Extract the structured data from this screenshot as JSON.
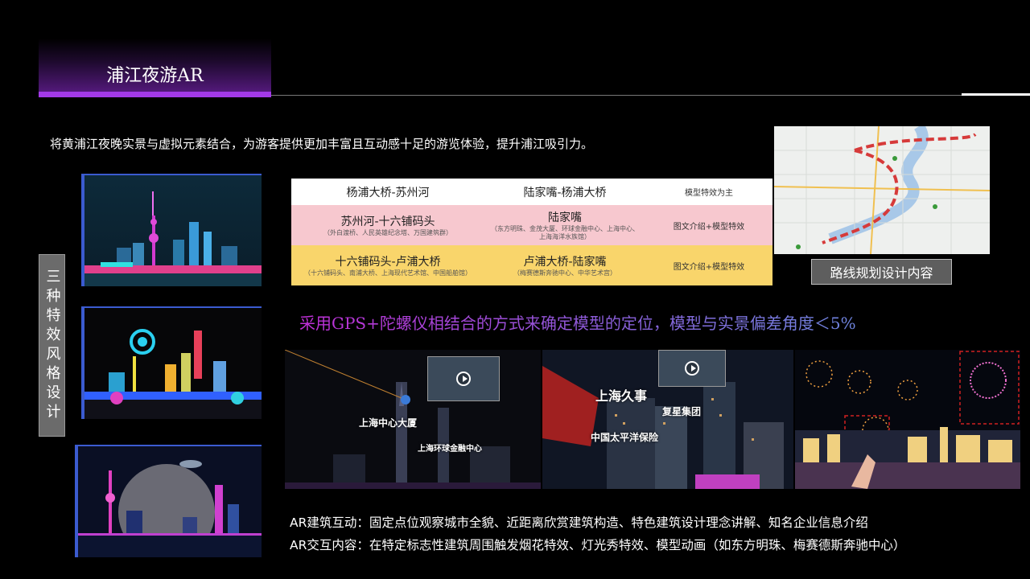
{
  "header": {
    "title": "浦江夜游AR"
  },
  "intro": "将黄浦江夜晚实景与虚拟元素结合，为游客提供更加丰富且互动感十足的游览体验，提升浦江吸引力。",
  "side_label": "三种特效风格设计",
  "route_table": {
    "header": [
      "杨浦大桥-苏州河",
      "陆家嘴-杨浦大桥",
      "模型特效为主"
    ],
    "rows": [
      {
        "route": "苏州河-十六铺码头",
        "route_detail": "（外白渡桥、人民英雄纪念塔、万国建筑群）",
        "area": "陆家嘴",
        "area_detail": "（东方明珠、金茂大厦、环球金融中心、上海中心、上海海洋水族馆）",
        "effect": "图文介绍+模型特效"
      },
      {
        "route": "十六铺码头-卢浦大桥",
        "route_detail": "（十六铺码头、南浦大桥、上海现代艺术馆、中国船舶馆）",
        "area": "卢浦大桥-陆家嘴",
        "area_detail": "（梅赛德斯奔驰中心、中华艺术宫）",
        "effect": "图文介绍+模型特效"
      }
    ]
  },
  "map": {
    "caption": "路线规划设计内容"
  },
  "gps_text": "采用GPS+陀螺仪相结合的方式来确定模型的定位，模型与实景偏差角度＜5%",
  "ar_shots": {
    "shot1": {
      "label_main": "上海中心大厦",
      "label_sub": "上海环球金融中心"
    },
    "shot2": {
      "label_main": "上海久事",
      "label_a": "复星集团",
      "label_b": "中国太平洋保险"
    }
  },
  "footer": {
    "line1": "AR建筑互动：固定点位观察城市全貌、近距离欣赏建筑构造、特色建筑设计理念讲解、知名企业信息介绍",
    "line2": "AR交互内容：在特定标志性建筑周围触发烟花特效、灯光秀特效、模型动画（如东方明珠、梅赛德斯奔驰中心）"
  },
  "colors": {
    "accent_purple": "#a339e8",
    "gps_start": "#c02fd8",
    "gps_end": "#6f86e0",
    "route_line": "#d63a3a"
  }
}
